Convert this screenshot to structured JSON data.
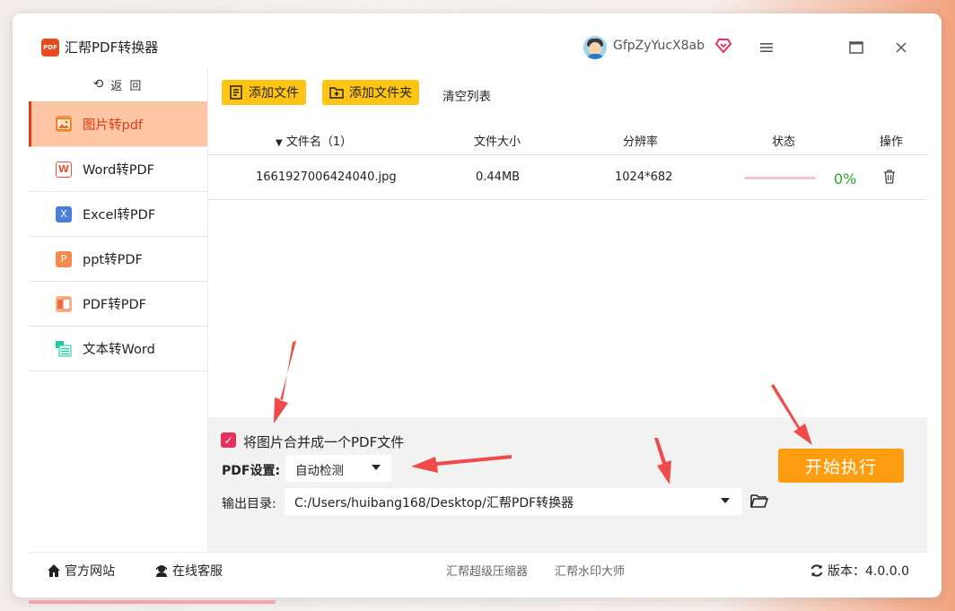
{
  "app": {
    "title": "汇帮PDF转换器",
    "logo_text": "PDF",
    "username": "GfpZyYucX8ab"
  },
  "sidebar": {
    "back_label": "返 回",
    "items": [
      {
        "label": "图片转pdf",
        "icon": "image-icon",
        "active": true
      },
      {
        "label": "Word转PDF",
        "icon": "word-icon",
        "active": false
      },
      {
        "label": "Excel转PDF",
        "icon": "excel-icon",
        "active": false
      },
      {
        "label": "ppt转PDF",
        "icon": "ppt-icon",
        "active": false
      },
      {
        "label": "PDF转PDF",
        "icon": "pdf-icon",
        "active": false
      },
      {
        "label": "文本转Word",
        "icon": "text-icon",
        "active": false
      }
    ]
  },
  "toolbar": {
    "add_file": "添加文件",
    "add_folder": "添加文件夹",
    "clear_list": "清空列表"
  },
  "table": {
    "headers": {
      "filename": "文件名（1）",
      "size": "文件大小",
      "resolution": "分辨率",
      "status": "状态",
      "action": "操作"
    },
    "rows": [
      {
        "filename": "1661927006424040.jpg",
        "size": "0.44MB",
        "resolution": "1024*682",
        "progress": 0,
        "percent": "0%"
      }
    ]
  },
  "settings": {
    "merge_label": "将图片合并成一个PDF文件",
    "merge_checked": true,
    "pdf_setting_label": "PDF设置:",
    "pdf_setting_value": "自动检测",
    "output_label": "输出目录:",
    "output_path": "C:/Users/huibang168/Desktop/汇帮PDF转换器",
    "start_button": "开始执行"
  },
  "footer": {
    "website": "官方网站",
    "support": "在线客服",
    "link1": "汇帮超级压缩器",
    "link2": "汇帮水印大师",
    "version": "版本：4.0.0.0"
  },
  "colors": {
    "accent_orange": "#ff9d11",
    "toolbar_yellow": "#ffc414",
    "active_nav_bg": "#ffc6a6",
    "active_nav_text": "#e23a12",
    "checkbox": "#e6315a",
    "percent_green": "#2aa52a",
    "annotation_arrow": "#f04a4a"
  }
}
